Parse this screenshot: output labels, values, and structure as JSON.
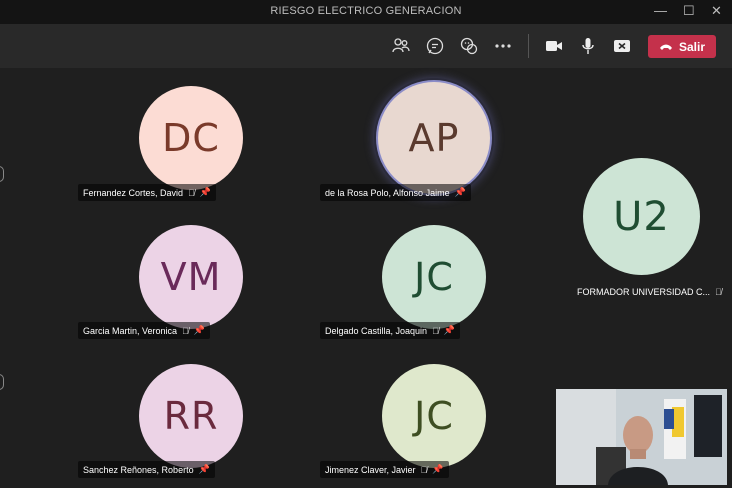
{
  "window": {
    "title": "RIESGO ELECTRICO GENERACION",
    "minimize_glyph": "—",
    "maximize_glyph": "☐",
    "close_glyph": "✕"
  },
  "toolbar": {
    "icons": [
      "participants-icon",
      "chat-icon",
      "reactions-icon",
      "more-actions-icon",
      "camera-icon",
      "microphone-icon",
      "share-screen-icon"
    ],
    "leave_label": "Salir",
    "leave_color": "#c4314b"
  },
  "participants": [
    {
      "initials": "DC",
      "name": "Fernandez Cortes, David",
      "bg": "#fcdcd4",
      "fg": "#7a3a2a",
      "muted": true,
      "pinned": true
    },
    {
      "initials": "AP",
      "name": "de la Rosa Polo, Alfonso Jaime",
      "bg": "#e8d8d0",
      "fg": "#5a3a2e",
      "muted": false,
      "pinned": true,
      "speaking": true
    },
    {
      "initials": "U2",
      "name": "FORMADOR UNIVERSIDAD C...",
      "bg": "#cde4d5",
      "fg": "#1f4d32",
      "muted": true,
      "pinned": false
    },
    {
      "initials": "VM",
      "name": "Garcia Martin, Veronica",
      "bg": "#ecd3e6",
      "fg": "#6a2a5a",
      "muted": true,
      "pinned": true
    },
    {
      "initials": "JC",
      "name": "Delgado Castilla, Joaquin",
      "bg": "#cde4d5",
      "fg": "#1f4d32",
      "muted": true,
      "pinned": true
    },
    {
      "initials": "RR",
      "name": "Sanchez Reñones, Roberto",
      "bg": "#ecd3e6",
      "fg": "#6a2a3e",
      "muted": false,
      "pinned": true
    },
    {
      "initials": "JC",
      "name": "Jimenez Claver, Javier",
      "bg": "#dfe8cc",
      "fg": "#3e4e22",
      "muted": true,
      "pinned": true
    }
  ]
}
